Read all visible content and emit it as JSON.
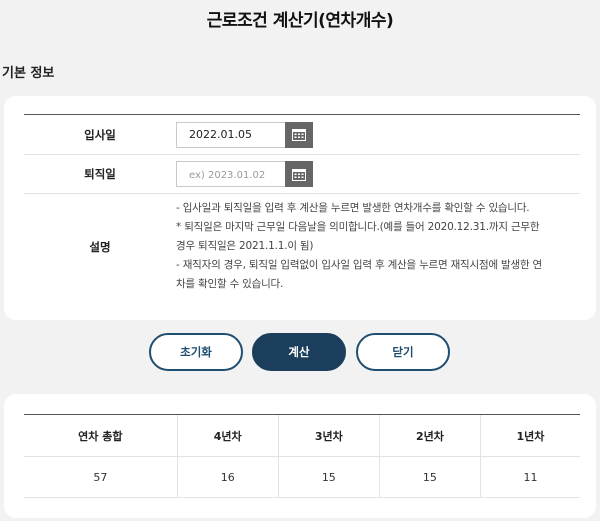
{
  "title": "근로조건 계산기(연차개수)",
  "section_title": "기본 정보",
  "form": {
    "join_date_label": "입사일",
    "join_date_value": "2022.01.05",
    "leave_date_label": "퇴직일",
    "leave_date_value": "",
    "leave_date_placeholder": "ex) 2023.01.02",
    "calendar_icon": "calendar-icon",
    "desc_label": "설명",
    "desc_lines": [
      "- 입사일과 퇴직일을 입력 후 계산을 누르면 발생한 연차개수를 확인할 수 있습니다.",
      "* 퇴직일은 마지막 근무일 다음날을 의미합니다.(예를 들어 2020.12.31.까지 근무한 경우 퇴직일은 2021.1.1.이 됨)",
      "- 재직자의 경우, 퇴직일 입력없이 입사일 입력 후 계산을 누르면 재직시점에 발생한 연차를 확인할 수 있습니다."
    ]
  },
  "buttons": {
    "reset": "초기화",
    "calc": "계산",
    "close": "닫기"
  },
  "result": {
    "headers": [
      "연차 총합",
      "4년차",
      "3년차",
      "2년차",
      "1년차"
    ],
    "values": [
      "57",
      "16",
      "15",
      "15",
      "11"
    ]
  },
  "colors": {
    "primary": "#1a3e5c",
    "outline": "#1f4e70",
    "background": "#f2f2f2",
    "calendar_button": "#666666"
  }
}
